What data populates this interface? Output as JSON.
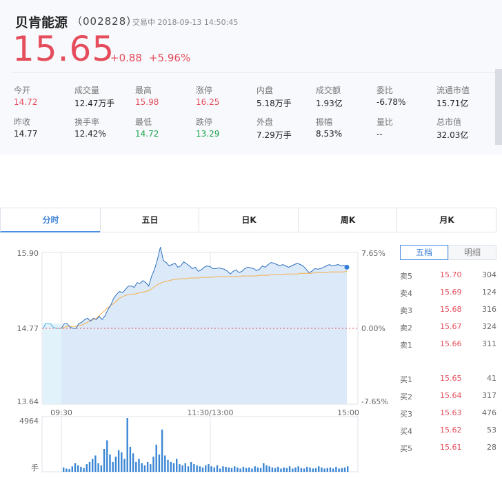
{
  "stock": {
    "name": "贝肯能源",
    "code": "（002828）",
    "status": "交易中 2018-09-13 14:50:45",
    "price": "15.65",
    "change": "+0.88",
    "change_pct": "+5.96%"
  },
  "stats": [
    {
      "label": "今开",
      "value": "14.72",
      "color": "red"
    },
    {
      "label": "成交量",
      "value": "12.47万手",
      "color": "normal"
    },
    {
      "label": "最高",
      "value": "15.98",
      "color": "red"
    },
    {
      "label": "涨停",
      "value": "16.25",
      "color": "red"
    },
    {
      "label": "内盘",
      "value": "5.18万手",
      "color": "normal"
    },
    {
      "label": "成交额",
      "value": "1.93亿",
      "color": "normal"
    },
    {
      "label": "委比",
      "value": "-6.78%",
      "color": "normal"
    },
    {
      "label": "流通市值",
      "value": "15.71亿",
      "color": "normal"
    },
    {
      "label": "昨收",
      "value": "14.77",
      "color": "normal"
    },
    {
      "label": "换手率",
      "value": "12.42%",
      "color": "normal"
    },
    {
      "label": "最低",
      "value": "14.72",
      "color": "green"
    },
    {
      "label": "跌停",
      "value": "13.29",
      "color": "green"
    },
    {
      "label": "外盘",
      "value": "7.29万手",
      "color": "normal"
    },
    {
      "label": "振幅",
      "value": "8.53%",
      "color": "normal"
    },
    {
      "label": "量比",
      "value": "--",
      "color": "normal"
    },
    {
      "label": "总市值",
      "value": "32.03亿",
      "color": "normal"
    }
  ],
  "tabs": [
    "分时",
    "五日",
    "日K",
    "周K",
    "月K"
  ],
  "active_tab": 0,
  "side_tabs": [
    "五档",
    "明细"
  ],
  "order_book": {
    "sell": [
      {
        "label": "卖5",
        "price": "15.70",
        "vol": "304"
      },
      {
        "label": "卖4",
        "price": "15.69",
        "vol": "124"
      },
      {
        "label": "卖3",
        "price": "15.68",
        "vol": "316"
      },
      {
        "label": "卖2",
        "price": "15.67",
        "vol": "324"
      },
      {
        "label": "卖1",
        "price": "15.66",
        "vol": "311"
      }
    ],
    "buy": [
      {
        "label": "买1",
        "price": "15.65",
        "vol": "41"
      },
      {
        "label": "买2",
        "price": "15.64",
        "vol": "317"
      },
      {
        "label": "买3",
        "price": "15.63",
        "vol": "476"
      },
      {
        "label": "买4",
        "price": "15.62",
        "vol": "53"
      },
      {
        "label": "买5",
        "price": "15.61",
        "vol": "28"
      }
    ]
  },
  "colors": {
    "up": "#e54d5c",
    "down": "#1aa34a",
    "accent": "#4a90e2",
    "avg_line": "#f5b04a",
    "fill": "#dce9f8"
  },
  "chart_data": {
    "type": "line",
    "y_left_labels": [
      "15.90",
      "14.77",
      "13.64"
    ],
    "y_right_labels": [
      "7.65%",
      "0.00%",
      "-7.65%"
    ],
    "x_labels": [
      "09:30",
      "11:30/13:00",
      "15:00"
    ],
    "ylim": [
      13.64,
      15.9
    ],
    "prev_close": 14.77,
    "price_series": [
      14.77,
      14.84,
      14.84,
      14.79,
      14.77,
      14.77,
      14.84,
      14.86,
      14.9,
      14.92,
      14.88,
      14.92,
      14.9,
      14.95,
      14.9,
      14.96,
      15.05,
      15.12,
      15.22,
      15.28,
      15.32,
      15.3,
      15.35,
      15.4,
      15.4,
      15.38,
      15.45,
      15.44,
      15.48,
      15.45,
      15.4,
      15.55,
      15.65,
      15.8,
      15.98,
      15.78,
      15.75,
      15.7,
      15.72,
      15.74,
      15.68,
      15.7,
      15.76,
      15.73,
      15.7,
      15.66,
      15.68,
      15.62,
      15.64,
      15.68,
      15.7,
      15.69,
      15.66,
      15.66,
      15.67,
      15.66,
      15.65,
      15.62,
      15.58,
      15.62,
      15.64,
      15.6,
      15.62,
      15.66,
      15.68,
      15.67,
      15.66,
      15.63,
      15.65,
      15.7,
      15.68,
      15.72,
      15.75,
      15.74,
      15.72,
      15.7,
      15.72,
      15.7,
      15.68,
      15.7,
      15.72,
      15.74,
      15.72,
      15.7,
      15.65,
      15.6,
      15.62,
      15.66,
      15.65,
      15.66,
      15.68,
      15.7,
      15.72,
      15.7,
      15.71,
      15.72,
      15.7,
      15.71,
      15.68
    ],
    "avg_series": [
      14.77,
      14.78,
      14.8,
      14.8,
      14.8,
      14.8,
      14.81,
      14.82,
      14.84,
      14.86,
      14.88,
      14.9,
      14.92,
      14.96,
      15.0,
      15.04,
      15.08,
      15.11,
      15.14,
      15.18,
      15.22,
      15.24,
      15.26,
      15.27,
      15.28,
      15.28,
      15.29,
      15.3,
      15.31,
      15.32,
      15.33,
      15.36,
      15.39,
      15.42,
      15.44,
      15.46,
      15.47,
      15.48,
      15.49,
      15.5,
      15.5,
      15.51,
      15.51,
      15.51,
      15.52,
      15.52,
      15.52,
      15.52,
      15.53,
      15.53,
      15.53,
      15.53,
      15.53,
      15.54,
      15.54,
      15.54,
      15.54,
      15.54,
      15.54,
      15.54,
      15.54,
      15.54,
      15.55,
      15.55,
      15.55,
      15.55,
      15.55,
      15.55,
      15.56,
      15.56,
      15.56,
      15.56,
      15.57,
      15.57,
      15.57,
      15.57,
      15.57,
      15.58,
      15.58,
      15.58,
      15.58,
      15.58,
      15.59,
      15.59,
      15.59,
      15.59,
      15.59,
      15.6,
      15.6,
      15.6,
      15.6,
      15.6,
      15.61,
      15.61,
      15.61,
      15.61,
      15.61,
      15.61,
      15.62
    ],
    "volume_max_label": "4964",
    "volume_unit": "手",
    "volume_max": 4964,
    "volume_series": [
      400,
      300,
      250,
      500,
      800,
      600,
      450,
      350,
      700,
      900,
      1200,
      1500,
      800,
      600,
      2100,
      2900,
      1600,
      900,
      1400,
      2000,
      1800,
      1200,
      4964,
      2300,
      1700,
      900,
      1200,
      800,
      600,
      900,
      700,
      1400,
      2500,
      1600,
      3900,
      1500,
      1100,
      900,
      800,
      1200,
      700,
      600,
      800,
      500,
      900,
      700,
      600,
      500,
      400,
      600,
      700,
      500,
      400,
      600,
      300,
      500,
      450,
      400,
      350,
      500,
      400,
      300,
      450,
      350,
      400,
      300,
      500,
      400,
      350,
      800,
      600,
      500,
      400,
      350,
      450,
      300,
      400,
      350,
      500,
      300,
      400,
      500,
      350,
      300,
      450,
      400,
      300,
      350,
      500,
      400,
      300,
      350,
      400,
      300,
      450,
      300,
      350,
      400,
      500
    ]
  }
}
